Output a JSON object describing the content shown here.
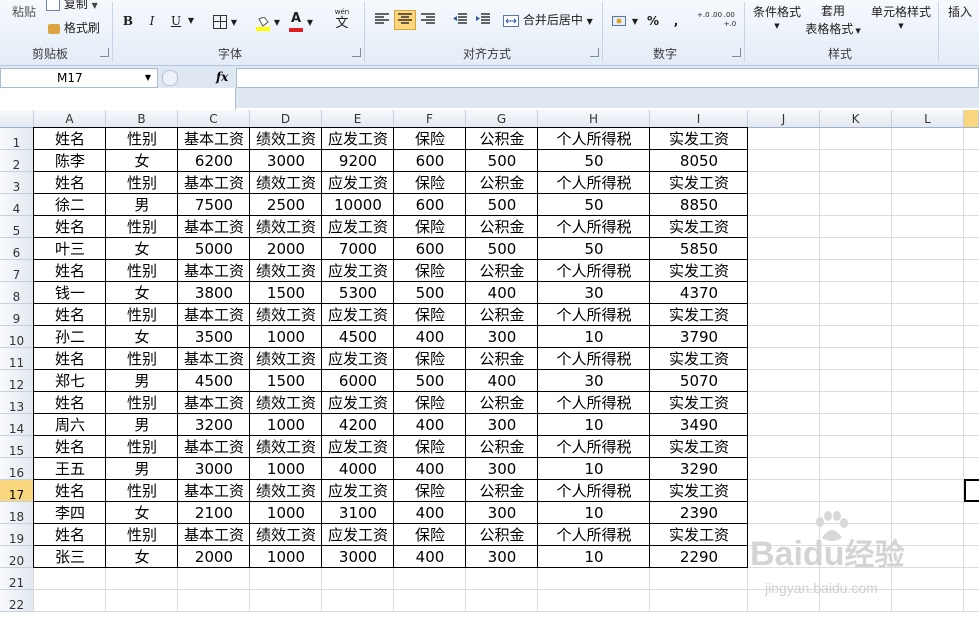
{
  "ribbon": {
    "clipboard": {
      "paste": "粘贴",
      "copy": "复制",
      "format_painter": "格式刷",
      "label": "剪贴板"
    },
    "font": {
      "bold": "B",
      "italic": "I",
      "underline": "U",
      "label": "字体",
      "wen": "wén",
      "wen_char": "文"
    },
    "alignment": {
      "merge_center": "合并后居中",
      "label": "对齐方式"
    },
    "number": {
      "percent": "%",
      "comma": ",",
      "inc_decimal": "+.0 .00",
      "dec_decimal": ".00 +.0",
      "label": "数字"
    },
    "styles": {
      "conditional": "条件格式",
      "table_format": "套用\n表格格式",
      "table_format_line1": "套用",
      "table_format_line2": "表格格式",
      "cell_styles": "单元格样式",
      "label": "样式"
    },
    "insert": "插入"
  },
  "formula_bar": {
    "name_box": "M17",
    "fx": "fx",
    "value": ""
  },
  "columns": [
    "A",
    "B",
    "C",
    "D",
    "E",
    "F",
    "G",
    "H",
    "I",
    "J",
    "K",
    "L"
  ],
  "selected_row": "17",
  "rows": [
    [
      "姓名",
      "性别",
      "基本工资",
      "绩效工资",
      "应发工资",
      "保险",
      "公积金",
      "个人所得税",
      "实发工资"
    ],
    [
      "陈李",
      "女",
      "6200",
      "3000",
      "9200",
      "600",
      "500",
      "50",
      "8050"
    ],
    [
      "姓名",
      "性别",
      "基本工资",
      "绩效工资",
      "应发工资",
      "保险",
      "公积金",
      "个人所得税",
      "实发工资"
    ],
    [
      "徐二",
      "男",
      "7500",
      "2500",
      "10000",
      "600",
      "500",
      "50",
      "8850"
    ],
    [
      "姓名",
      "性别",
      "基本工资",
      "绩效工资",
      "应发工资",
      "保险",
      "公积金",
      "个人所得税",
      "实发工资"
    ],
    [
      "叶三",
      "女",
      "5000",
      "2000",
      "7000",
      "600",
      "500",
      "50",
      "5850"
    ],
    [
      "姓名",
      "性别",
      "基本工资",
      "绩效工资",
      "应发工资",
      "保险",
      "公积金",
      "个人所得税",
      "实发工资"
    ],
    [
      "钱一",
      "女",
      "3800",
      "1500",
      "5300",
      "500",
      "400",
      "30",
      "4370"
    ],
    [
      "姓名",
      "性别",
      "基本工资",
      "绩效工资",
      "应发工资",
      "保险",
      "公积金",
      "个人所得税",
      "实发工资"
    ],
    [
      "孙二",
      "女",
      "3500",
      "1000",
      "4500",
      "400",
      "300",
      "10",
      "3790"
    ],
    [
      "姓名",
      "性别",
      "基本工资",
      "绩效工资",
      "应发工资",
      "保险",
      "公积金",
      "个人所得税",
      "实发工资"
    ],
    [
      "郑七",
      "男",
      "4500",
      "1500",
      "6000",
      "500",
      "400",
      "30",
      "5070"
    ],
    [
      "姓名",
      "性别",
      "基本工资",
      "绩效工资",
      "应发工资",
      "保险",
      "公积金",
      "个人所得税",
      "实发工资"
    ],
    [
      "周六",
      "男",
      "3200",
      "1000",
      "4200",
      "400",
      "300",
      "10",
      "3490"
    ],
    [
      "姓名",
      "性别",
      "基本工资",
      "绩效工资",
      "应发工资",
      "保险",
      "公积金",
      "个人所得税",
      "实发工资"
    ],
    [
      "王五",
      "男",
      "3000",
      "1000",
      "4000",
      "400",
      "300",
      "10",
      "3290"
    ],
    [
      "姓名",
      "性别",
      "基本工资",
      "绩效工资",
      "应发工资",
      "保险",
      "公积金",
      "个人所得税",
      "实发工资"
    ],
    [
      "李四",
      "女",
      "2100",
      "1000",
      "3100",
      "400",
      "300",
      "10",
      "2390"
    ],
    [
      "姓名",
      "性别",
      "基本工资",
      "绩效工资",
      "应发工资",
      "保险",
      "公积金",
      "个人所得税",
      "实发工资"
    ],
    [
      "张三",
      "女",
      "2000",
      "1000",
      "3000",
      "400",
      "300",
      "10",
      "2290"
    ],
    [],
    []
  ],
  "watermark": {
    "brand": "Bai",
    "brand2": "du",
    "cn": "经验",
    "url": "jingyan.baidu.com"
  },
  "colors": {
    "ribbon_bg": "#e4ecf7",
    "selected_header": "#f9d77e",
    "font_color_red": "#e02020",
    "fill_yellow": "#ffff00"
  },
  "icons": [
    "paste-icon",
    "copy-icon",
    "format-painter-icon",
    "border-icon",
    "fill-color-icon",
    "font-color-icon",
    "phonetic-icon",
    "align-left-icon",
    "align-center-icon",
    "align-right-icon",
    "indent-decrease-icon",
    "indent-increase-icon",
    "merge-center-icon",
    "accounting-format-icon",
    "fx-icon",
    "dropdown-arrow-icon"
  ]
}
